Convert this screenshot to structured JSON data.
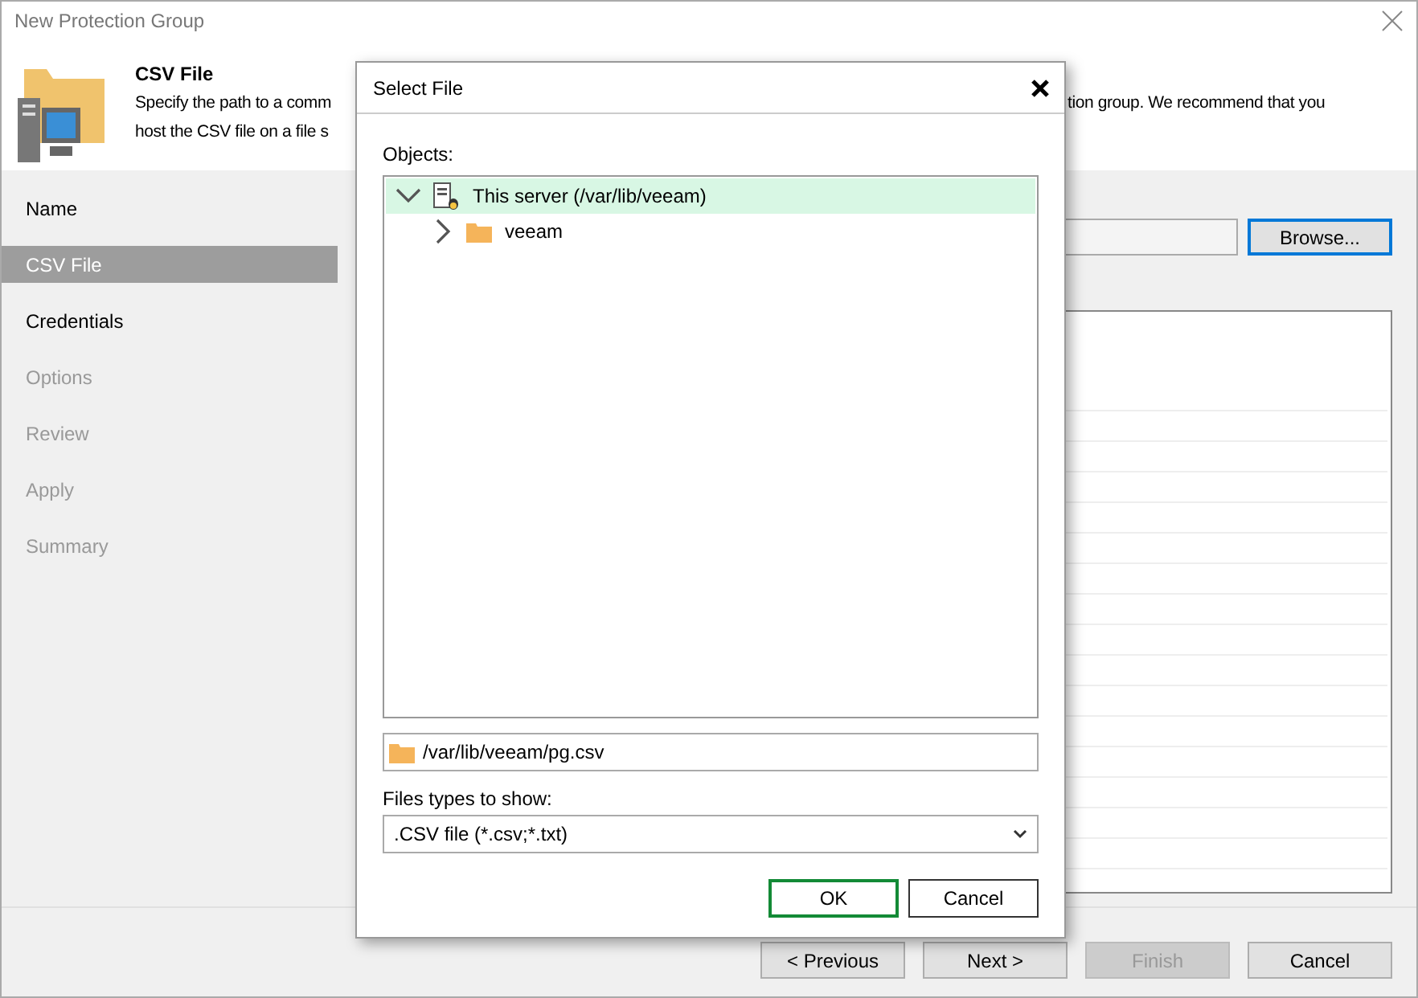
{
  "window": {
    "title": "New Protection Group"
  },
  "header": {
    "title": "CSV File",
    "description_left": [
      "Specify the path to a comm",
      "host the CSV file on a file s"
    ],
    "description_right": "tion group. We recommend that you"
  },
  "steps": [
    {
      "label": "Name",
      "selected": false,
      "disabled": false
    },
    {
      "label": "CSV File",
      "selected": true,
      "disabled": false
    },
    {
      "label": "Credentials",
      "selected": false,
      "disabled": false
    },
    {
      "label": "Options",
      "selected": false,
      "disabled": true
    },
    {
      "label": "Review",
      "selected": false,
      "disabled": true
    },
    {
      "label": "Apply",
      "selected": false,
      "disabled": true
    },
    {
      "label": "Summary",
      "selected": false,
      "disabled": true
    }
  ],
  "browse_button": "Browse...",
  "nav_buttons": [
    {
      "label": "< Previous",
      "disabled": false
    },
    {
      "label": "Next >",
      "disabled": false
    },
    {
      "label": "Finish",
      "disabled": true
    },
    {
      "label": "Cancel",
      "disabled": false
    }
  ],
  "dialog": {
    "title": "Select File",
    "objects_label": "Objects:",
    "tree": [
      {
        "label": "This server (/var/lib/veeam)",
        "kind": "server",
        "expanded": true,
        "selected": true,
        "children": [
          {
            "label": "veeam",
            "kind": "folder",
            "expanded": false,
            "selected": false
          }
        ]
      }
    ],
    "path": "/var/lib/veeam/pg.csv",
    "file_types_label": "Files types to show:",
    "file_type": ".CSV file (*.csv;*.txt)",
    "buttons": [
      {
        "label": "OK",
        "default": true
      },
      {
        "label": "Cancel",
        "default": false
      }
    ]
  }
}
